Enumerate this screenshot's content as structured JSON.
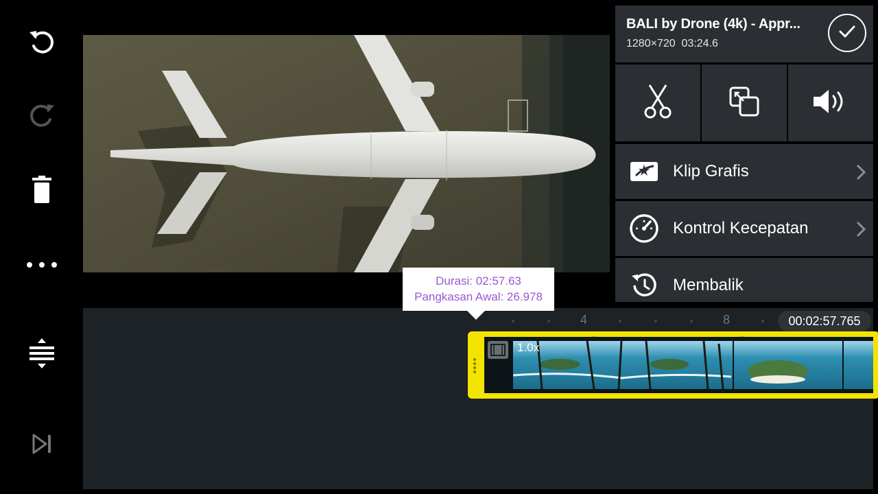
{
  "left_toolbar": {
    "icons": [
      "undo-icon",
      "redo-icon",
      "trash-icon",
      "more-icon",
      "expand-timeline-icon",
      "skip-to-end-icon"
    ]
  },
  "clip_info": {
    "title": "BALI by Drone (4k) - Appr...",
    "resolution": "1280×720",
    "duration": "03:24.6"
  },
  "action_icons": [
    "scissors-icon",
    "crop-icon",
    "volume-icon"
  ],
  "menu": [
    {
      "label": "Klip Grafis",
      "icon": "clip-graphics-icon",
      "chevron": true
    },
    {
      "label": "Kontrol Kecepatan",
      "icon": "speedometer-icon",
      "chevron": true
    },
    {
      "label": "Membalik",
      "icon": "reverse-icon",
      "chevron": false
    }
  ],
  "tooltip": {
    "line1": "Durasi: 02:57.63",
    "line2": "Pangkasan Awal: 26.978"
  },
  "timeline": {
    "ruler_labels": [
      "4",
      "8"
    ],
    "timecode": "00:02:57.765",
    "clip_speed": "1.0x"
  },
  "colors": {
    "accent_yellow": "#f2e400",
    "panel": "#2b2f33",
    "timeline_bg": "#1c2226",
    "tooltip_text": "#9a59d1"
  }
}
